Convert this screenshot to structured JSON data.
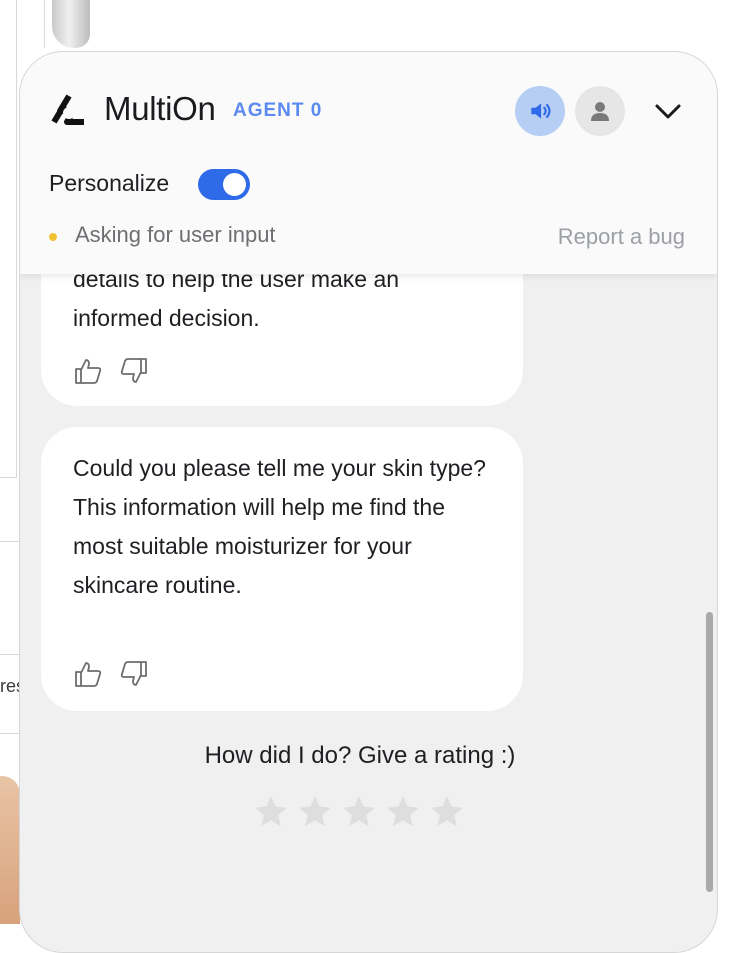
{
  "header": {
    "brand": "MultiOn",
    "agent_label": "AGENT 0",
    "personalize_label": "Personalize",
    "personalize_on": true,
    "status_text": "Asking for user input",
    "status_color": "#f1c232",
    "report_bug": "Report a bug",
    "accent_color": "#2f6be8"
  },
  "messages": [
    {
      "text": "details to help the user make an informed decision."
    },
    {
      "text": "Could you please tell me your skin type? This information will help me find the most suitable moisturizer for your skincare routine."
    }
  ],
  "rating": {
    "prompt": "How did I do? Give a rating :)",
    "stars_total": 5,
    "stars_filled": 0
  },
  "background": {
    "fragment_text": "res"
  }
}
